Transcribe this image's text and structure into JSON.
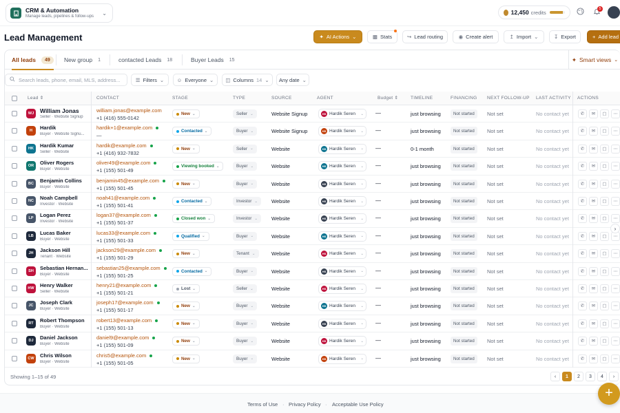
{
  "workspace": {
    "title": "CRM & Automation",
    "subtitle": "Manage leads, pipelines & follow-ups"
  },
  "credits": {
    "amount": "12,450",
    "label": "credits",
    "level": 0.88
  },
  "notifications": {
    "count": "5"
  },
  "header": {
    "title": "Lead Management",
    "ai_actions": "AI Actions",
    "stats": "Stats",
    "lead_routing": "Lead routing",
    "create_alert": "Create alert",
    "import": "Import",
    "export": "Export",
    "add_lead": "Add lead"
  },
  "tabs": [
    {
      "label": "All leads",
      "count": "49"
    },
    {
      "label": "New group",
      "count": "1"
    },
    {
      "label": "contacted Leads",
      "count": "18"
    },
    {
      "label": "Buyer Leads",
      "count": "15"
    }
  ],
  "smart_views": "Smart views",
  "filters": {
    "search_placeholder": "Search leads, phone, email, MLS, address...",
    "filters": "Filters",
    "everyone": "Everyone",
    "columns": "Columns",
    "columns_count": "14",
    "any_date": "Any date"
  },
  "columns": [
    "Lead",
    "CONTACT",
    "STAGE",
    "TYPE",
    "SOURCE",
    "AGENT",
    "Budget",
    "TIMELINE",
    "FINANCING",
    "NEXT FOLLOW-UP",
    "LAST ACTIVITY",
    "ACTIONS"
  ],
  "leads": [
    {
      "initials": "WJ",
      "color": "#be123c",
      "name": "William Jonas",
      "sub": "Seller · Website Signup",
      "email": "william.jonas@example.com",
      "online": false,
      "phone": "+1 (416) 555-0142",
      "stage": "New",
      "stage_color": "#ca8a04",
      "stage_text": "#92400e",
      "type": "Seller",
      "source": "Website Signup",
      "agent": "Hardik Seren",
      "agent_color": "#be123c",
      "budget": "—",
      "timeline": "just browsing",
      "financing": "Not started",
      "follow": "Not set",
      "last": "No contact yet"
    },
    {
      "initials": "H",
      "color": "#c2410c",
      "name": "Hardik",
      "sub": "Buyer · Website Signu...",
      "email": "hardik+1@example.com",
      "online": true,
      "phone": "—",
      "stage": "Contacted",
      "stage_color": "#0ea5e9",
      "stage_text": "#0369a1",
      "type": "Buyer",
      "source": "Website Signup",
      "agent": "Hardik Seren",
      "agent_color": "#c2410c",
      "budget": "—",
      "timeline": "just browsing",
      "financing": "Not started",
      "follow": "Not set",
      "last": "No contact yet"
    },
    {
      "initials": "HK",
      "color": "#0e7490",
      "name": "Hardik Kumar",
      "sub": "Seller · Website",
      "email": "hardik@example.com",
      "online": true,
      "phone": "+1 (416) 932-7832",
      "stage": "New",
      "stage_color": "#ca8a04",
      "stage_text": "#92400e",
      "type": "Seller",
      "source": "Website",
      "agent": "Hardik Seren",
      "agent_color": "#0e7490",
      "budget": "—",
      "timeline": "0-1 month",
      "financing": "Not started",
      "follow": "Not set",
      "last": "No contact yet"
    },
    {
      "initials": "OR",
      "color": "#0f766e",
      "name": "Oliver Rogers",
      "sub": "Buyer · Website",
      "email": "oliver49@example.com",
      "online": true,
      "phone": "+1 (155) 501-49",
      "stage": "Viewing booked",
      "stage_color": "#16a34a",
      "stage_text": "#15803d",
      "type": "Buyer",
      "source": "Website",
      "agent": "Hardik Seren",
      "agent_color": "#0e7490",
      "budget": "—",
      "timeline": "just browsing",
      "financing": "Not started",
      "follow": "Not set",
      "last": "No contact yet"
    },
    {
      "initials": "BC",
      "color": "#475569",
      "name": "Benjamin Collins",
      "sub": "Buyer · Website",
      "email": "benjamin45@example.com",
      "online": true,
      "phone": "+1 (155) 501-45",
      "stage": "New",
      "stage_color": "#ca8a04",
      "stage_text": "#92400e",
      "type": "Buyer",
      "source": "Website",
      "agent": "Hardik Seren",
      "agent_color": "#374151",
      "budget": "—",
      "timeline": "just browsing",
      "financing": "Not started",
      "follow": "Not set",
      "last": "No contact yet"
    },
    {
      "initials": "NC",
      "color": "#475569",
      "name": "Noah Campbell",
      "sub": "Investor · Website",
      "email": "noah41@example.com",
      "online": true,
      "phone": "+1 (155) 501-41",
      "stage": "Contacted",
      "stage_color": "#0ea5e9",
      "stage_text": "#0369a1",
      "type": "Investor",
      "source": "Website",
      "agent": "Hardik Seren",
      "agent_color": "#374151",
      "budget": "—",
      "timeline": "just browsing",
      "financing": "Not started",
      "follow": "Not set",
      "last": "No contact yet"
    },
    {
      "initials": "LP",
      "color": "#475569",
      "name": "Logan Perez",
      "sub": "Investor · Website",
      "email": "logan37@example.com",
      "online": true,
      "phone": "+1 (155) 501-37",
      "stage": "Closed won",
      "stage_color": "#16a34a",
      "stage_text": "#15803d",
      "type": "Investor",
      "source": "Website",
      "agent": "Hardik Seren",
      "agent_color": "#374151",
      "budget": "—",
      "timeline": "just browsing",
      "financing": "Not started",
      "follow": "Not set",
      "last": "No contact yet"
    },
    {
      "initials": "LB",
      "color": "#1e293b",
      "name": "Lucas Baker",
      "sub": "Buyer · Website",
      "email": "lucas33@example.com",
      "online": true,
      "phone": "+1 (155) 501-33",
      "stage": "Qualified",
      "stage_color": "#0ea5e9",
      "stage_text": "#0369a1",
      "type": "Buyer",
      "source": "Website",
      "agent": "Hardik Seren",
      "agent_color": "#0e7490",
      "budget": "—",
      "timeline": "just browsing",
      "financing": "Not started",
      "follow": "Not set",
      "last": "No contact yet"
    },
    {
      "initials": "JH",
      "color": "#1e293b",
      "name": "Jackson Hill",
      "sub": "Tenant · Website",
      "email": "jackson29@example.com",
      "online": true,
      "phone": "+1 (155) 501-29",
      "stage": "New",
      "stage_color": "#ca8a04",
      "stage_text": "#92400e",
      "type": "Tenant",
      "source": "Website",
      "agent": "Hardik Seren",
      "agent_color": "#be123c",
      "budget": "—",
      "timeline": "just browsing",
      "financing": "Not started",
      "follow": "Not set",
      "last": "No contact yet"
    },
    {
      "initials": "SH",
      "color": "#be123c",
      "name": "Sebastian Hernan...",
      "sub": "Buyer · Website",
      "email": "sebastian25@example.com",
      "online": true,
      "phone": "+1 (155) 501-25",
      "stage": "Contacted",
      "stage_color": "#0ea5e9",
      "stage_text": "#0369a1",
      "type": "Buyer",
      "source": "Website",
      "agent": "Hardik Seren",
      "agent_color": "#374151",
      "budget": "—",
      "timeline": "just browsing",
      "financing": "Not started",
      "follow": "Not set",
      "last": "No contact yet"
    },
    {
      "initials": "HW",
      "color": "#be123c",
      "name": "Henry Walker",
      "sub": "Seller · Website",
      "email": "henry21@example.com",
      "online": true,
      "phone": "+1 (155) 501-21",
      "stage": "Lost",
      "stage_color": "#9ca3af",
      "stage_text": "#4b5563",
      "type": "Seller",
      "source": "Website",
      "agent": "Hardik Seren",
      "agent_color": "#be123c",
      "budget": "—",
      "timeline": "just browsing",
      "financing": "Not started",
      "follow": "Not set",
      "last": "No contact yet"
    },
    {
      "initials": "JC",
      "color": "#475569",
      "name": "Joseph Clark",
      "sub": "Buyer · Website",
      "email": "joseph17@example.com",
      "online": true,
      "phone": "+1 (155) 501-17",
      "stage": "New",
      "stage_color": "#ca8a04",
      "stage_text": "#92400e",
      "type": "Buyer",
      "source": "Website",
      "agent": "Hardik Seren",
      "agent_color": "#0e7490",
      "budget": "—",
      "timeline": "just browsing",
      "financing": "Not started",
      "follow": "Not set",
      "last": "No contact yet"
    },
    {
      "initials": "RT",
      "color": "#1e293b",
      "name": "Robert Thompson",
      "sub": "Buyer · Website",
      "email": "robert13@example.com",
      "online": true,
      "phone": "+1 (155) 501-13",
      "stage": "New",
      "stage_color": "#ca8a04",
      "stage_text": "#92400e",
      "type": "Buyer",
      "source": "Website",
      "agent": "Hardik Seren",
      "agent_color": "#374151",
      "budget": "—",
      "timeline": "just browsing",
      "financing": "Not started",
      "follow": "Not set",
      "last": "No contact yet"
    },
    {
      "initials": "DJ",
      "color": "#1e293b",
      "name": "Daniel Jackson",
      "sub": "Buyer · Website",
      "email": "daniel9@example.com",
      "online": true,
      "phone": "+1 (155) 501-09",
      "stage": "New",
      "stage_color": "#ca8a04",
      "stage_text": "#92400e",
      "type": "Buyer",
      "source": "Website",
      "agent": "Hardik Seren",
      "agent_color": "#be123c",
      "budget": "—",
      "timeline": "just browsing",
      "financing": "Not started",
      "follow": "Not set",
      "last": "No contact yet"
    },
    {
      "initials": "CW",
      "color": "#c2410c",
      "name": "Chris Wilson",
      "sub": "Buyer · Website",
      "email": "chris5@example.com",
      "online": true,
      "phone": "+1 (155) 501-05",
      "stage": "New",
      "stage_color": "#ca8a04",
      "stage_text": "#92400e",
      "type": "Buyer",
      "source": "Website",
      "agent": "Hardik Seren",
      "agent_color": "#c2410c",
      "budget": "—",
      "timeline": "just browsing",
      "financing": "Not started",
      "follow": "Not set",
      "last": "No contact yet"
    }
  ],
  "pagination": {
    "showing": "Showing 1–15 of 49",
    "pages": [
      "1",
      "2",
      "3",
      "4"
    ],
    "current": "1"
  },
  "footer": {
    "terms": "Terms of Use",
    "privacy": "Privacy Policy",
    "acceptable": "Acceptable Use Policy"
  },
  "icons": {
    "workspace": "building-icon",
    "theme": "palette-icon",
    "bell": "bell-icon",
    "fab": "plus-icon"
  },
  "accent": "#c98a1e"
}
